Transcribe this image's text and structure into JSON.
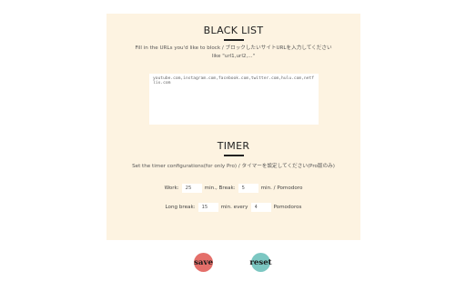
{
  "blacklist": {
    "title": "BLACK LIST",
    "description_line1": "Fill in the URLs you'd like to block / ブロックしたいサイトURLを入力してください",
    "description_line2": "like \"url1,url2,...\"",
    "textarea_value": "youtube.com,instagram.com,facebook.com,twitter.com,hulu.com,netflix.com"
  },
  "timer": {
    "title": "TIMER",
    "description": "Set the timer configurations(for only Pro) / タイマーを設定してください(Pro版のみ)",
    "row1": {
      "work_label": "Work:",
      "work_value": "25",
      "work_unit": "min., Break:",
      "break_value": "5",
      "break_unit": "min. / Pomodoro"
    },
    "row2": {
      "long_break_label": "Long break:",
      "long_break_value": "15",
      "every_label": "min. every",
      "every_value": "4",
      "pomodoros_label": "Pomodoros"
    }
  },
  "buttons": {
    "save_label": "save",
    "reset_label": "reset"
  },
  "colors": {
    "panel_background": "#fdf3e1",
    "save_button": "#e46f6a",
    "reset_button": "#7cc7c2"
  }
}
